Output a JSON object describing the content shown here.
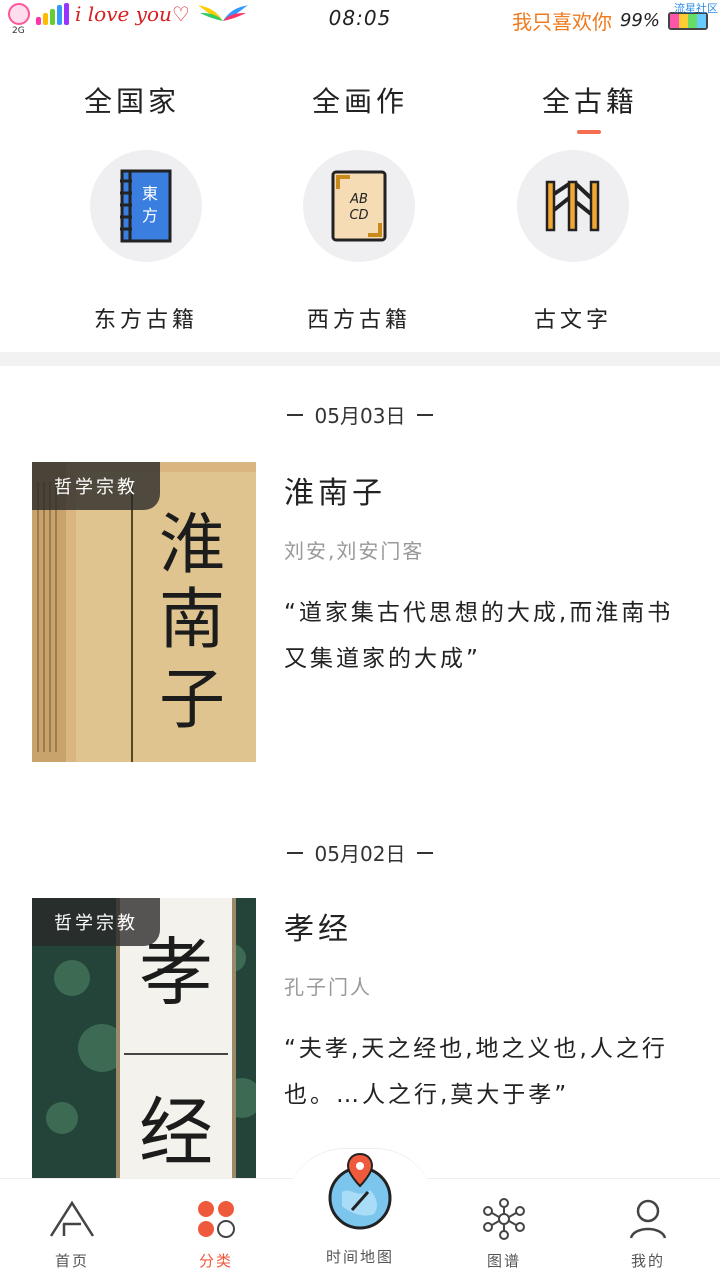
{
  "status_bar": {
    "love_text": "i love you♡",
    "signal": "2G",
    "time": "08:05",
    "slogan": "我只喜欢你",
    "battery_pct": "99%",
    "community": "流星社区"
  },
  "tabs": [
    {
      "label": "全国家",
      "active": false
    },
    {
      "label": "全画作",
      "active": false
    },
    {
      "label": "全古籍",
      "active": true
    }
  ],
  "categories": [
    {
      "label": "东方古籍",
      "icon": "book-east-icon",
      "icon_text": "東方"
    },
    {
      "label": "西方古籍",
      "icon": "book-west-icon",
      "icon_text": "ABCD"
    },
    {
      "label": "古文字",
      "icon": "ancient-script-icon"
    }
  ],
  "list": [
    {
      "date": "05月03日",
      "tag": "哲学宗教",
      "title": "淮南子",
      "author": "刘安,刘安门客",
      "quote": "“道家集古代思想的大成,而淮南书又集道家的大成”",
      "cover_text": "淮南子"
    },
    {
      "date": "05月02日",
      "tag": "哲学宗教",
      "title": "孝经",
      "author": "孔子门人",
      "quote": "“夫孝,天之经也,地之义也,人之行也。…人之行,莫大于孝”",
      "cover_text": "孝经"
    }
  ],
  "bottom_nav": [
    {
      "label": "首页",
      "icon": "home-icon",
      "active": false
    },
    {
      "label": "分类",
      "icon": "category-icon",
      "active": true
    },
    {
      "label": "时间地图",
      "icon": "timemap-icon",
      "active": false
    },
    {
      "label": "图谱",
      "icon": "graph-icon",
      "active": false
    },
    {
      "label": "我的",
      "icon": "profile-icon",
      "active": false
    }
  ],
  "colors": {
    "accent": "#f05a3c",
    "tab_indicator": "#f46f4f",
    "tag_bg": "#282828"
  }
}
